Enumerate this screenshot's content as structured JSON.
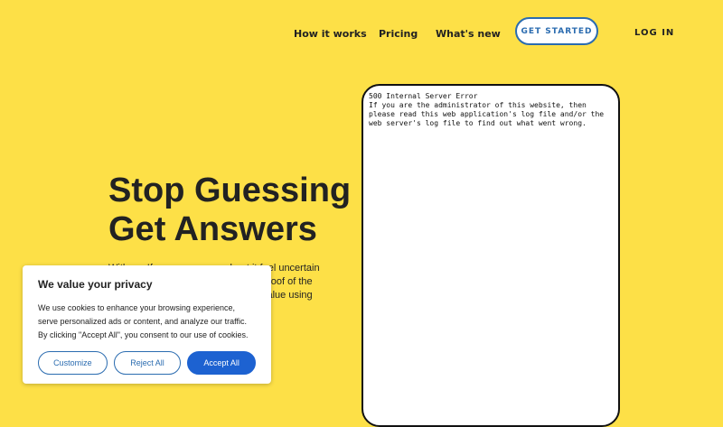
{
  "colors": {
    "background": "#fde047",
    "accent_blue": "#2b6cb0",
    "accept_blue": "#1d62d1",
    "text_dark": "#222222",
    "card_bg": "#ffffff"
  },
  "nav": {
    "items": [
      {
        "label": "How it works"
      },
      {
        "label": "Pricing"
      },
      {
        "label": "What's new"
      }
    ],
    "get_started": "GET STARTED",
    "login": "LOG IN"
  },
  "hero": {
    "title_line1": "Stop Guessing",
    "title_line2": "Get Answers",
    "subtext_line1": "With us. If you are unsure about it feel uncertain",
    "subtext_line2": "proof of the value using"
  },
  "phone": {
    "error_text": "500 Internal Server Error\nIf you are the administrator of this website, then\nplease read this web application's log file and/or the\nweb server's log file to find out what went wrong."
  },
  "cookie_banner": {
    "title": "We value your privacy",
    "text": "We use cookies to enhance your browsing experience, serve personalized ads or content, and analyze our traffic. By clicking \"Accept All\", you consent to our use of cookies.",
    "customize": "Customize",
    "reject": "Reject All",
    "accept": "Accept All"
  }
}
